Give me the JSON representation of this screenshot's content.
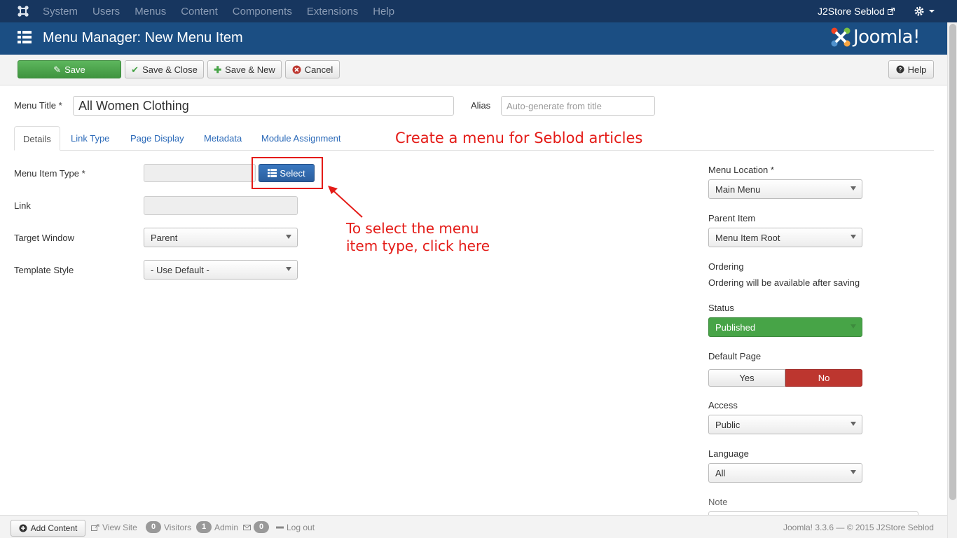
{
  "topnav": {
    "menu": [
      "System",
      "Users",
      "Menus",
      "Content",
      "Components",
      "Extensions",
      "Help"
    ],
    "site_name": "J2Store Seblod"
  },
  "header": {
    "title": "Menu Manager: New Menu Item",
    "brand": "Joomla!"
  },
  "toolbar": {
    "save": "Save",
    "save_close": "Save & Close",
    "save_new": "Save & New",
    "cancel": "Cancel",
    "help": "Help"
  },
  "form": {
    "menu_title_label": "Menu Title *",
    "menu_title_value": "All Women Clothing",
    "alias_label": "Alias",
    "alias_placeholder": "Auto-generate from title"
  },
  "tabs": [
    "Details",
    "Link Type",
    "Page Display",
    "Metadata",
    "Module Assignment"
  ],
  "details": {
    "menu_item_type_label": "Menu Item Type *",
    "select_button": "Select",
    "link_label": "Link",
    "target_window_label": "Target Window",
    "target_window_value": "Parent",
    "template_style_label": "Template Style",
    "template_style_value": "- Use Default -"
  },
  "sidebar": {
    "menu_location_label": "Menu Location *",
    "menu_location_value": "Main Menu",
    "parent_item_label": "Parent Item",
    "parent_item_value": "Menu Item Root",
    "ordering_label": "Ordering",
    "ordering_text": "Ordering will be available after saving",
    "status_label": "Status",
    "status_value": "Published",
    "default_page_label": "Default Page",
    "default_yes": "Yes",
    "default_no": "No",
    "access_label": "Access",
    "access_value": "Public",
    "language_label": "Language",
    "language_value": "All",
    "note_label": "Note"
  },
  "annotations": {
    "heading": "Create a menu for Seblod articles",
    "hint_line1": "To select the menu",
    "hint_line2": "item type, click here"
  },
  "footer": {
    "add_content": "Add Content",
    "view_site": "View Site",
    "visitors_count": "0",
    "visitors": "Visitors",
    "admin_count": "1",
    "admin": "Admin",
    "mail_count": "0",
    "logout": "Log out",
    "copyright": "Joomla! 3.3.6 — © 2015 J2Store Seblod"
  },
  "colors": {
    "topnav": "#17365f",
    "header": "#1b4e83",
    "save_green": "#47a447",
    "no_red": "#bd362f",
    "annotation_red": "#e41b17"
  }
}
